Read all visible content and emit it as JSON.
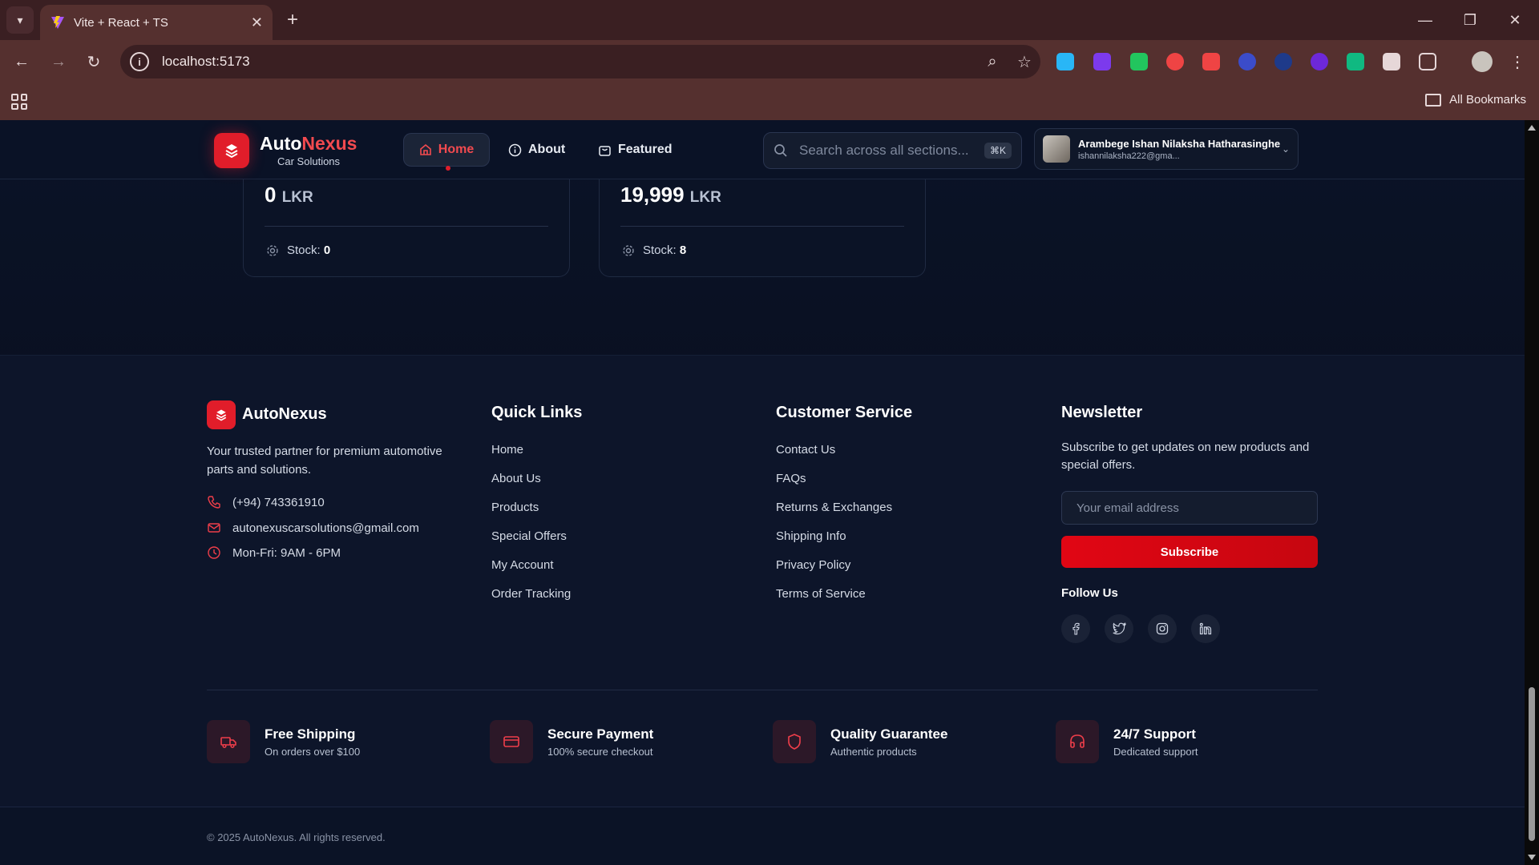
{
  "browser": {
    "tab_title": "Vite + React + TS",
    "url": "localhost:5173",
    "bookmarks_label": "All Bookmarks"
  },
  "header": {
    "brand_first": "Auto",
    "brand_second": "Nexus",
    "brand_sub": "Car Solutions",
    "nav": {
      "home": "Home",
      "about": "About",
      "featured": "Featured"
    },
    "search_placeholder": "Search across all sections...",
    "search_shortcut": "⌘K",
    "user": {
      "name": "Arambege Ishan Nilaksha Hatharasinghe",
      "email": "ishannilaksha222@gma..."
    }
  },
  "products": [
    {
      "price": "0",
      "currency": "LKR",
      "stock_label": "Stock:",
      "stock": "0"
    },
    {
      "price": "19,999",
      "currency": "LKR",
      "stock_label": "Stock:",
      "stock": "8"
    }
  ],
  "footer": {
    "brand": "AutoNexus",
    "description": "Your trusted partner for premium automotive parts and solutions.",
    "phone": "(+94) 743361910",
    "email": "autonexuscarsolutions@gmail.com",
    "hours": "Mon-Fri: 9AM - 6PM",
    "quick_links_title": "Quick Links",
    "quick_links": [
      "Home",
      "About Us",
      "Products",
      "Special Offers",
      "My Account",
      "Order Tracking"
    ],
    "customer_service_title": "Customer Service",
    "customer_service": [
      "Contact Us",
      "FAQs",
      "Returns & Exchanges",
      "Shipping Info",
      "Privacy Policy",
      "Terms of Service"
    ],
    "newsletter_title": "Newsletter",
    "newsletter_desc": "Subscribe to get updates on new products and special offers.",
    "newsletter_placeholder": "Your email address",
    "subscribe_label": "Subscribe",
    "follow_label": "Follow Us",
    "social_icons": [
      "facebook-icon",
      "twitter-icon",
      "instagram-icon",
      "linkedin-icon"
    ],
    "features": [
      {
        "title": "Free Shipping",
        "sub": "On orders over $100",
        "icon": "truck-icon"
      },
      {
        "title": "Secure Payment",
        "sub": "100% secure checkout",
        "icon": "credit-card-icon"
      },
      {
        "title": "Quality Guarantee",
        "sub": "Authentic products",
        "icon": "shield-icon"
      },
      {
        "title": "24/7 Support",
        "sub": "Dedicated support",
        "icon": "headphones-icon"
      }
    ],
    "copyright": "© 2025 AutoNexus. All rights reserved."
  },
  "colors": {
    "accent": "#e11d2a",
    "accent_text": "#f24a4f",
    "background": "#0b1224"
  }
}
